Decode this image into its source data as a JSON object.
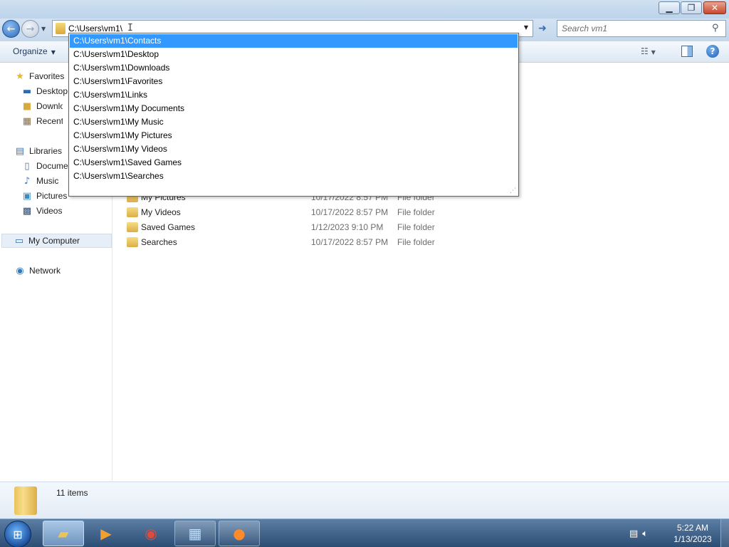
{
  "window": {
    "minimize_icon": "minimize-icon",
    "maximize_icon": "restore-icon",
    "close_icon": "close-icon"
  },
  "nav": {
    "address_value": "C:\\Users\\vm1\\",
    "search_placeholder": "Search vm1"
  },
  "toolbar": {
    "organize_label": "Organize"
  },
  "autocomplete": [
    "C:\\Users\\vm1\\Contacts",
    "C:\\Users\\vm1\\Desktop",
    "C:\\Users\\vm1\\Downloads",
    "C:\\Users\\vm1\\Favorites",
    "C:\\Users\\vm1\\Links",
    "C:\\Users\\vm1\\My Documents",
    "C:\\Users\\vm1\\My Music",
    "C:\\Users\\vm1\\My Pictures",
    "C:\\Users\\vm1\\My Videos",
    "C:\\Users\\vm1\\Saved Games",
    "C:\\Users\\vm1\\Searches"
  ],
  "sidebar": {
    "favorites": "Favorites",
    "desktop": "Desktop",
    "downloads": "Downloads",
    "recent": "Recent Places",
    "libraries": "Libraries",
    "documents": "Documents",
    "music": "Music",
    "pictures": "Pictures",
    "videos": "Videos",
    "computer": "My Computer",
    "network": "Network"
  },
  "files": [
    {
      "name": "My Pictures",
      "date": "10/17/2022 8:57 PM",
      "type": "File folder"
    },
    {
      "name": "My Videos",
      "date": "10/17/2022 8:57 PM",
      "type": "File folder"
    },
    {
      "name": "Saved Games",
      "date": "1/12/2023 9:10 PM",
      "type": "File folder"
    },
    {
      "name": "Searches",
      "date": "10/17/2022 8:57 PM",
      "type": "File folder"
    }
  ],
  "details": {
    "count": "11 items"
  },
  "taskbar": {
    "time": "5:22 AM",
    "date": "1/13/2023"
  },
  "colors": {
    "selection": "#3399ff",
    "taskbar": "#2c4d74"
  }
}
